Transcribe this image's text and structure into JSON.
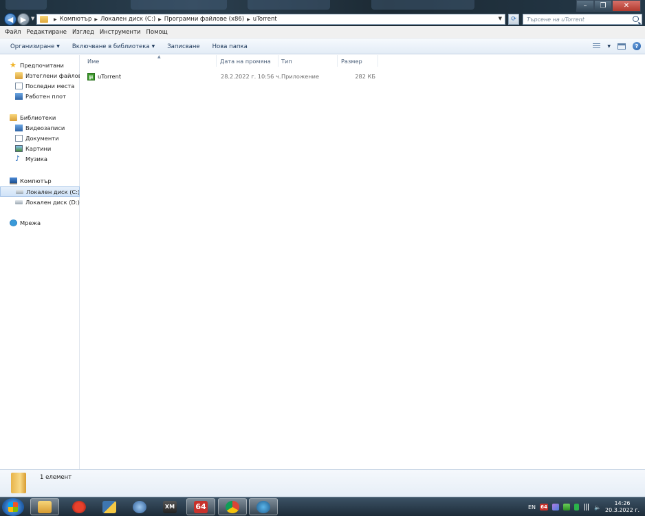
{
  "window": {
    "minimize_glyph": "–",
    "maximize_glyph": "❐",
    "close_glyph": "✕"
  },
  "address": {
    "breadcrumbs": [
      "Компютър",
      "Локален диск (C:)",
      "Програмни файлове (x86)",
      "uTorrent"
    ],
    "search_placeholder": "Търсене на uTorrent"
  },
  "menu": [
    "Файл",
    "Редактиране",
    "Изглед",
    "Инструменти",
    "Помощ"
  ],
  "commands": {
    "organize": "Организиране",
    "include_library": "Включване в библиотека",
    "burn": "Записване",
    "new_folder": "Нова папка"
  },
  "nav": {
    "favorites": "Предпочитани",
    "downloads": "Изтеглени файлове",
    "recent": "Последни места",
    "desktop": "Работен плот",
    "libraries": "Библиотеки",
    "videos": "Видеозаписи",
    "documents": "Документи",
    "pictures": "Картини",
    "music": "Музика",
    "computer": "Компютър",
    "drive_c": "Локален диск (C:)",
    "drive_d": "Локален диск (D:)",
    "network": "Мрежа"
  },
  "columns": {
    "name": "Име",
    "date": "Дата на промяна",
    "type": "Тип",
    "size": "Размер"
  },
  "files": [
    {
      "name": "uTorrent",
      "date": "28.2.2022 г. 10:56 ч.",
      "type": "Приложение",
      "size": "282 КБ",
      "icon": "utorrent-app-icon"
    }
  ],
  "status": {
    "count": "1 елемент"
  },
  "taskbar": {
    "apps": [
      "windows-explorer",
      "ccleaner",
      "python",
      "network-tool",
      "xmplay",
      "aida64",
      "chrome",
      "audio-app"
    ],
    "aida_label": "64",
    "xm_label": "XM",
    "lang": "EN",
    "tray_64": "64",
    "time": "14:26",
    "date": "20.3.2022 г."
  }
}
